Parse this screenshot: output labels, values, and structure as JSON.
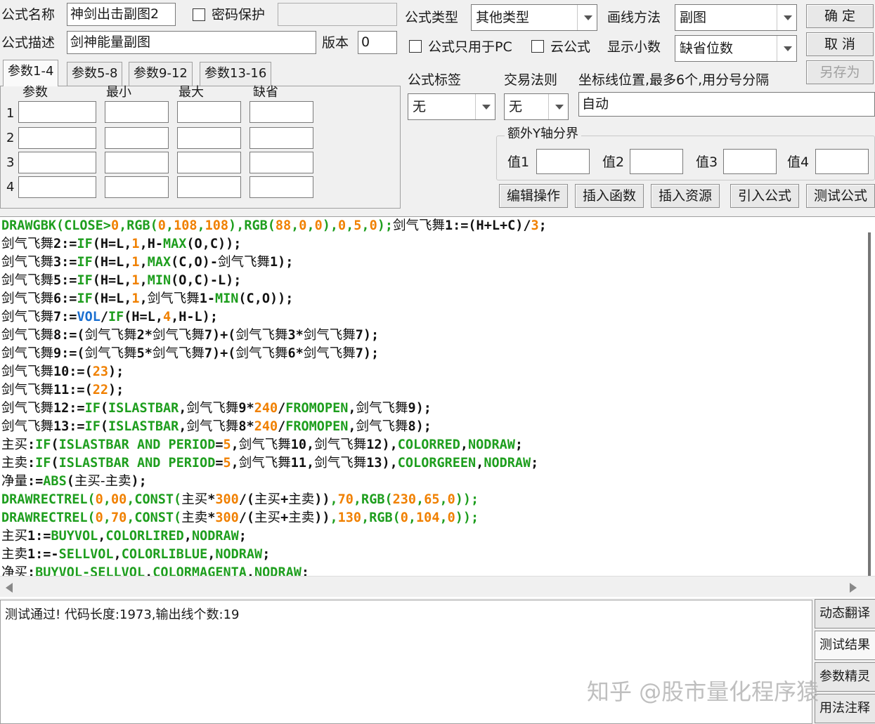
{
  "top": {
    "name_label": "公式名称",
    "name_value": "神剑出击副图2",
    "password_label": "密码保护",
    "password_value": "",
    "desc_label": "公式描述",
    "desc_value": "剑神能量副图",
    "version_label": "版本",
    "version_value": "0",
    "type_label": "公式类型",
    "type_value": "其他类型",
    "draw_label": "画线方法",
    "draw_value": "副图",
    "pc_only_label": "公式只用于PC",
    "cloud_label": "云公式",
    "decimal_label": "显示小数",
    "decimal_value": "缺省位数",
    "tag_label": "公式标签",
    "tag_value": "无",
    "trade_label": "交易法则",
    "trade_value": "无",
    "axis_label": "坐标线位置,最多6个,用分号分隔",
    "axis_value": "自动",
    "extra_y_label": "额外Y轴分界",
    "val_labels": [
      "值1",
      "值2",
      "值3",
      "值4"
    ]
  },
  "buttons": {
    "ok": "确 定",
    "cancel": "取 消",
    "save_as": "另存为",
    "edit_ops": "编辑操作",
    "insert_func": "插入函数",
    "insert_res": "插入资源",
    "import_formula": "引入公式",
    "test_formula": "测试公式"
  },
  "tabs": [
    "参数1-4",
    "参数5-8",
    "参数9-12",
    "参数13-16"
  ],
  "param_headers": [
    "参数",
    "最小",
    "最大",
    "缺省"
  ],
  "param_rows": [
    "1",
    "2",
    "3",
    "4"
  ],
  "code_lines": [
    [
      [
        "g",
        "DRAWGBK("
      ],
      [
        "g",
        "CLOSE>"
      ],
      [
        "o",
        "0"
      ],
      [
        "g",
        ",RGB("
      ],
      [
        "o",
        "0"
      ],
      [
        "g",
        ","
      ],
      [
        "o",
        "108"
      ],
      [
        "g",
        ","
      ],
      [
        "o",
        "108"
      ],
      [
        "g",
        "),RGB("
      ],
      [
        "o",
        "88"
      ],
      [
        "g",
        ","
      ],
      [
        "o",
        "0"
      ],
      [
        "g",
        ","
      ],
      [
        "o",
        "0"
      ],
      [
        "g",
        "),"
      ],
      [
        "o",
        "0"
      ],
      [
        "g",
        ","
      ],
      [
        "o",
        "5"
      ],
      [
        "g",
        ","
      ],
      [
        "o",
        "0"
      ],
      [
        "g",
        ");"
      ],
      [
        "cn",
        "剑气飞舞"
      ],
      [
        "k",
        "1:=(H+L+C)/"
      ],
      [
        "o",
        "3"
      ],
      [
        "k",
        ";"
      ]
    ],
    [
      [
        "cn",
        "剑气飞舞"
      ],
      [
        "k",
        "2:="
      ],
      [
        "g",
        "IF"
      ],
      [
        "k",
        "(H=L,"
      ],
      [
        "o",
        "1"
      ],
      [
        "k",
        ",H-"
      ],
      [
        "g",
        "MAX"
      ],
      [
        "k",
        "(O,C));"
      ]
    ],
    [
      [
        "cn",
        "剑气飞舞"
      ],
      [
        "k",
        "3:="
      ],
      [
        "g",
        "IF"
      ],
      [
        "k",
        "(H=L,"
      ],
      [
        "o",
        "1"
      ],
      [
        "k",
        ","
      ],
      [
        "g",
        "MAX"
      ],
      [
        "k",
        "(C,O)-"
      ],
      [
        "cn",
        "剑气飞舞"
      ],
      [
        "k",
        "1);"
      ]
    ],
    [
      [
        "cn",
        "剑气飞舞"
      ],
      [
        "k",
        "5:="
      ],
      [
        "g",
        "IF"
      ],
      [
        "k",
        "(H=L,"
      ],
      [
        "o",
        "1"
      ],
      [
        "k",
        ","
      ],
      [
        "g",
        "MIN"
      ],
      [
        "k",
        "(O,C)-L);"
      ]
    ],
    [
      [
        "cn",
        "剑气飞舞"
      ],
      [
        "k",
        "6:="
      ],
      [
        "g",
        "IF"
      ],
      [
        "k",
        "(H=L,"
      ],
      [
        "o",
        "1"
      ],
      [
        "k",
        ","
      ],
      [
        "cn",
        "剑气飞舞"
      ],
      [
        "k",
        "1-"
      ],
      [
        "g",
        "MIN"
      ],
      [
        "k",
        "(C,O));"
      ]
    ],
    [
      [
        "cn",
        "剑气飞舞"
      ],
      [
        "k",
        "7:="
      ],
      [
        "b",
        "VOL"
      ],
      [
        "k",
        "/"
      ],
      [
        "g",
        "IF"
      ],
      [
        "k",
        "(H=L,"
      ],
      [
        "o",
        "4"
      ],
      [
        "k",
        ",H-L);"
      ]
    ],
    [
      [
        "cn",
        "剑气飞舞"
      ],
      [
        "k",
        "8:=("
      ],
      [
        "cn",
        "剑气飞舞"
      ],
      [
        "k",
        "2*"
      ],
      [
        "cn",
        "剑气飞舞"
      ],
      [
        "k",
        "7)+("
      ],
      [
        "cn",
        "剑气飞舞"
      ],
      [
        "k",
        "3*"
      ],
      [
        "cn",
        "剑气飞舞"
      ],
      [
        "k",
        "7);"
      ]
    ],
    [
      [
        "cn",
        "剑气飞舞"
      ],
      [
        "k",
        "9:=("
      ],
      [
        "cn",
        "剑气飞舞"
      ],
      [
        "k",
        "5*"
      ],
      [
        "cn",
        "剑气飞舞"
      ],
      [
        "k",
        "7)+("
      ],
      [
        "cn",
        "剑气飞舞"
      ],
      [
        "k",
        "6*"
      ],
      [
        "cn",
        "剑气飞舞"
      ],
      [
        "k",
        "7);"
      ]
    ],
    [
      [
        "cn",
        "剑气飞舞"
      ],
      [
        "k",
        "10:=("
      ],
      [
        "o",
        "23"
      ],
      [
        "k",
        ");"
      ]
    ],
    [
      [
        "cn",
        "剑气飞舞"
      ],
      [
        "k",
        "11:=("
      ],
      [
        "o",
        "22"
      ],
      [
        "k",
        ");"
      ]
    ],
    [
      [
        "cn",
        "剑气飞舞"
      ],
      [
        "k",
        "12:="
      ],
      [
        "g",
        "IF"
      ],
      [
        "k",
        "("
      ],
      [
        "g",
        "ISLASTBAR"
      ],
      [
        "k",
        ","
      ],
      [
        "cn",
        "剑气飞舞"
      ],
      [
        "k",
        "9*"
      ],
      [
        "o",
        "240"
      ],
      [
        "k",
        "/"
      ],
      [
        "g",
        "FROMOPEN"
      ],
      [
        "k",
        ","
      ],
      [
        "cn",
        "剑气飞舞"
      ],
      [
        "k",
        "9);"
      ]
    ],
    [
      [
        "cn",
        "剑气飞舞"
      ],
      [
        "k",
        "13:="
      ],
      [
        "g",
        "IF"
      ],
      [
        "k",
        "("
      ],
      [
        "g",
        "ISLASTBAR"
      ],
      [
        "k",
        ","
      ],
      [
        "cn",
        "剑气飞舞"
      ],
      [
        "k",
        "8*"
      ],
      [
        "o",
        "240"
      ],
      [
        "k",
        "/"
      ],
      [
        "g",
        "FROMOPEN"
      ],
      [
        "k",
        ","
      ],
      [
        "cn",
        "剑气飞舞"
      ],
      [
        "k",
        "8);"
      ]
    ],
    [
      [
        "cn",
        "主买"
      ],
      [
        "k",
        ":"
      ],
      [
        "g",
        "IF"
      ],
      [
        "k",
        "("
      ],
      [
        "g",
        "ISLASTBAR AND PERIOD"
      ],
      [
        "k",
        "="
      ],
      [
        "o",
        "5"
      ],
      [
        "k",
        ","
      ],
      [
        "cn",
        "剑气飞舞"
      ],
      [
        "k",
        "10,"
      ],
      [
        "cn",
        "剑气飞舞"
      ],
      [
        "k",
        "12),"
      ],
      [
        "g",
        "COLORRED"
      ],
      [
        "k",
        ","
      ],
      [
        "g",
        "NODRAW"
      ],
      [
        "k",
        ";"
      ]
    ],
    [
      [
        "cn",
        "主卖"
      ],
      [
        "k",
        ":"
      ],
      [
        "g",
        "IF"
      ],
      [
        "k",
        "("
      ],
      [
        "g",
        "ISLASTBAR AND PERIOD"
      ],
      [
        "k",
        "="
      ],
      [
        "o",
        "5"
      ],
      [
        "k",
        ","
      ],
      [
        "cn",
        "剑气飞舞"
      ],
      [
        "k",
        "11,"
      ],
      [
        "cn",
        "剑气飞舞"
      ],
      [
        "k",
        "13),"
      ],
      [
        "g",
        "COLORGREEN"
      ],
      [
        "k",
        ","
      ],
      [
        "g",
        "NODRAW"
      ],
      [
        "k",
        ";"
      ]
    ],
    [
      [
        "cn",
        "净量"
      ],
      [
        "k",
        ":="
      ],
      [
        "g",
        "ABS"
      ],
      [
        "k",
        "("
      ],
      [
        "cn",
        "主买-主卖"
      ],
      [
        "k",
        ");"
      ]
    ],
    [
      [
        "g",
        "DRAWRECTREL("
      ],
      [
        "o",
        "0"
      ],
      [
        "g",
        ","
      ],
      [
        "o",
        "00"
      ],
      [
        "g",
        ",CONST("
      ],
      [
        "cn",
        "主买"
      ],
      [
        "k",
        "*"
      ],
      [
        "o",
        "300"
      ],
      [
        "k",
        "/("
      ],
      [
        "cn",
        "主买"
      ],
      [
        "k",
        "+"
      ],
      [
        "cn",
        "主卖"
      ],
      [
        "k",
        "))"
      ],
      [
        "g",
        ","
      ],
      [
        "o",
        "70"
      ],
      [
        "g",
        ",RGB("
      ],
      [
        "o",
        "230"
      ],
      [
        "g",
        ","
      ],
      [
        "o",
        "65"
      ],
      [
        "g",
        ","
      ],
      [
        "o",
        "0"
      ],
      [
        "g",
        "));"
      ]
    ],
    [
      [
        "g",
        "DRAWRECTREL("
      ],
      [
        "o",
        "0"
      ],
      [
        "g",
        ","
      ],
      [
        "o",
        "70"
      ],
      [
        "g",
        ",CONST("
      ],
      [
        "cn",
        "主卖"
      ],
      [
        "k",
        "*"
      ],
      [
        "o",
        "300"
      ],
      [
        "k",
        "/("
      ],
      [
        "cn",
        "主买"
      ],
      [
        "k",
        "+"
      ],
      [
        "cn",
        "主卖"
      ],
      [
        "k",
        "))"
      ],
      [
        "g",
        ","
      ],
      [
        "o",
        "130"
      ],
      [
        "g",
        ",RGB("
      ],
      [
        "o",
        "0"
      ],
      [
        "g",
        ","
      ],
      [
        "o",
        "104"
      ],
      [
        "g",
        ","
      ],
      [
        "o",
        "0"
      ],
      [
        "g",
        "));"
      ]
    ],
    [
      [
        "cn",
        "主买"
      ],
      [
        "k",
        "1:="
      ],
      [
        "g",
        "BUYVOL"
      ],
      [
        "k",
        ","
      ],
      [
        "g",
        "COLORLIRED"
      ],
      [
        "k",
        ","
      ],
      [
        "g",
        "NODRAW"
      ],
      [
        "k",
        ";"
      ]
    ],
    [
      [
        "cn",
        "主卖"
      ],
      [
        "k",
        "1:=-"
      ],
      [
        "g",
        "SELLVOL"
      ],
      [
        "k",
        ","
      ],
      [
        "g",
        "COLORLIBLUE"
      ],
      [
        "k",
        ","
      ],
      [
        "g",
        "NODRAW"
      ],
      [
        "k",
        ";"
      ]
    ],
    [
      [
        "cn",
        "净买"
      ],
      [
        "k",
        ":"
      ],
      [
        "g",
        "BUYVOL-SELLVOL"
      ],
      [
        "k",
        "."
      ],
      [
        "g",
        "COLORMAGENTA"
      ],
      [
        "k",
        "."
      ],
      [
        "g",
        "NODRAW"
      ],
      [
        "k",
        ":"
      ]
    ]
  ],
  "output_text": "测试通过! 代码长度:1973,输出线个数:19",
  "side_buttons": [
    "动态翻译",
    "测试结果",
    "参数精灵",
    "用法注释"
  ],
  "watermark": "知乎 @股市量化程序猿"
}
